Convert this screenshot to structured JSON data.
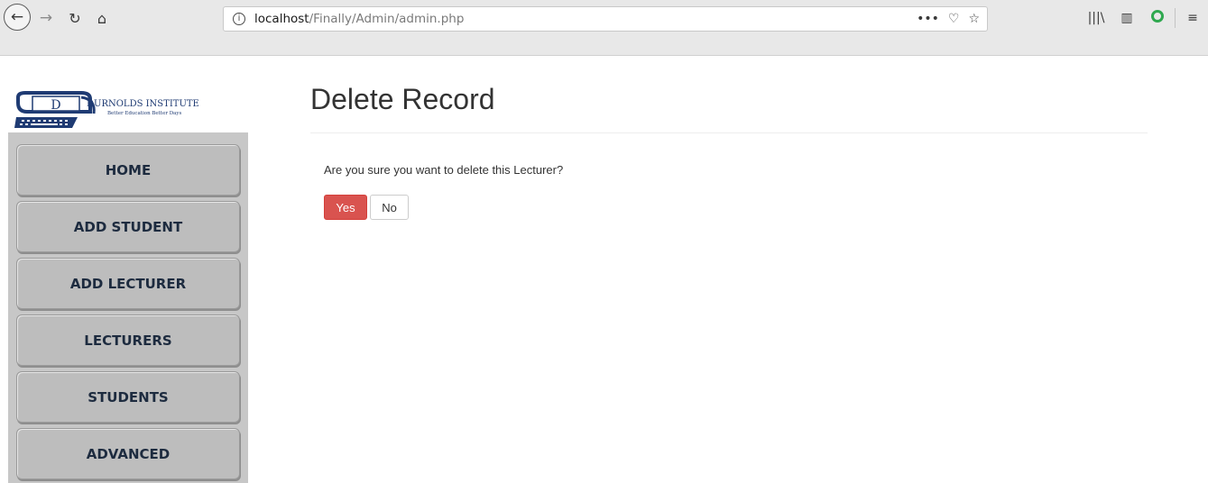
{
  "browser": {
    "url_host": "localhost",
    "url_path": "/Finally/Admin/admin.php",
    "back_glyph": "←",
    "forward_glyph": "→",
    "reload_glyph": "↻",
    "home_glyph": "⌂",
    "info_glyph": "i",
    "more_glyph": "•••",
    "pocket_glyph": "♡",
    "bookmark_glyph": "☆",
    "library_glyph": "|||\\",
    "sidebar_glyph": "▥",
    "menu_glyph": "≡"
  },
  "logo": {
    "letter": "D",
    "name": "DURNOLDS INSTITUTE",
    "tagline": "Better Education Better Days"
  },
  "sidebar": {
    "items": [
      {
        "label": "HOME"
      },
      {
        "label": "ADD STUDENT"
      },
      {
        "label": "ADD LECTURER"
      },
      {
        "label": "LECTURERS"
      },
      {
        "label": "STUDENTS"
      },
      {
        "label": "ADVANCED"
      }
    ]
  },
  "main": {
    "title": "Delete Record",
    "confirm_text": "Are you sure you want to delete this Lecturer?",
    "yes_label": "Yes",
    "no_label": "No"
  },
  "colors": {
    "danger": "#d9534f",
    "sidebar_bg": "#c7c7c7",
    "menu_text": "#1d2b3f",
    "logo_blue": "#1f3b73"
  }
}
